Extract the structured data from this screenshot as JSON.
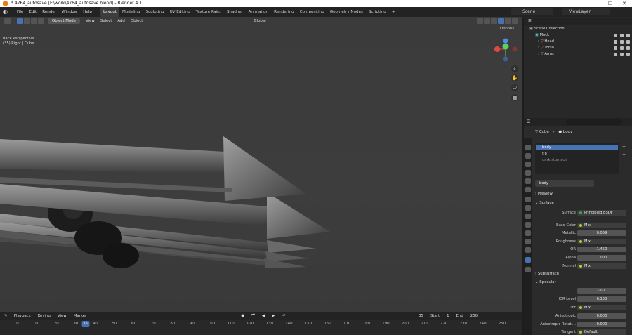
{
  "window": {
    "title": "* 4764_autosave [F:\\work\\4764_autosave.blend] - Blender 4.1",
    "controls": [
      "—",
      "☐",
      "✕"
    ]
  },
  "menu": [
    "File",
    "Edit",
    "Render",
    "Window",
    "Help"
  ],
  "workspaces": [
    "Layout",
    "Modeling",
    "Sculpting",
    "UV Editing",
    "Texture Paint",
    "Shading",
    "Animation",
    "Rendering",
    "Compositing",
    "Geometry Nodes",
    "Scripting"
  ],
  "active_workspace": "Layout",
  "add_workspace": "+",
  "scene": "Scene",
  "view_layer": "ViewLayer",
  "viewport": {
    "mode": "Object Mode",
    "menu": [
      "View",
      "Select",
      "Add",
      "Object"
    ],
    "transform_orientation": "Global",
    "info_line1": "Back Perspective",
    "info_line2": "(35) Right | Cube",
    "options": "Options"
  },
  "outliner": {
    "search_placeholder": "",
    "root": "Scene Collection",
    "collection": "Mock",
    "items": [
      "Head",
      "Torso",
      "Arms"
    ]
  },
  "properties": {
    "breadcrumb_object": "Cube",
    "breadcrumb_material": "body",
    "materials": [
      "body",
      "tip",
      "dark stomach"
    ],
    "material_name": "body",
    "sections": {
      "preview": "Preview",
      "surface": "Surface",
      "subsurface": "Subsurface",
      "specular": "Specular"
    },
    "fields": [
      {
        "label": "Surface",
        "value": "Principled BSDF"
      },
      {
        "label": "Base Color",
        "value": "Mix"
      },
      {
        "label": "Metallic",
        "value": "0.059"
      },
      {
        "label": "Roughness",
        "value": "Mix"
      },
      {
        "label": "IOR",
        "value": "1.450"
      },
      {
        "label": "Alpha",
        "value": "1.000"
      },
      {
        "label": "Normal",
        "value": "Mix"
      }
    ],
    "specular_distribution": "GGX",
    "specular_fields": [
      {
        "label": "IOR Level",
        "value": "0.150"
      },
      {
        "label": "Tint",
        "value": "Mix"
      },
      {
        "label": "Anisotropic",
        "value": "0.000"
      },
      {
        "label": "Anisotropic Rotati...",
        "value": "0.000"
      },
      {
        "label": "Tangent",
        "value": "Default"
      }
    ]
  },
  "timeline": {
    "menu": [
      "Playback",
      "Keying",
      "View",
      "Marker"
    ],
    "current_frame": "35",
    "start_label": "Start",
    "start": "1",
    "end_label": "End",
    "end": "250",
    "ticks": [
      "0",
      "10",
      "20",
      "30",
      "40",
      "50",
      "60",
      "70",
      "80",
      "90",
      "100",
      "110",
      "120",
      "130",
      "140",
      "150",
      "160",
      "170",
      "180",
      "190",
      "200",
      "210",
      "220",
      "230",
      "240",
      "250"
    ]
  }
}
